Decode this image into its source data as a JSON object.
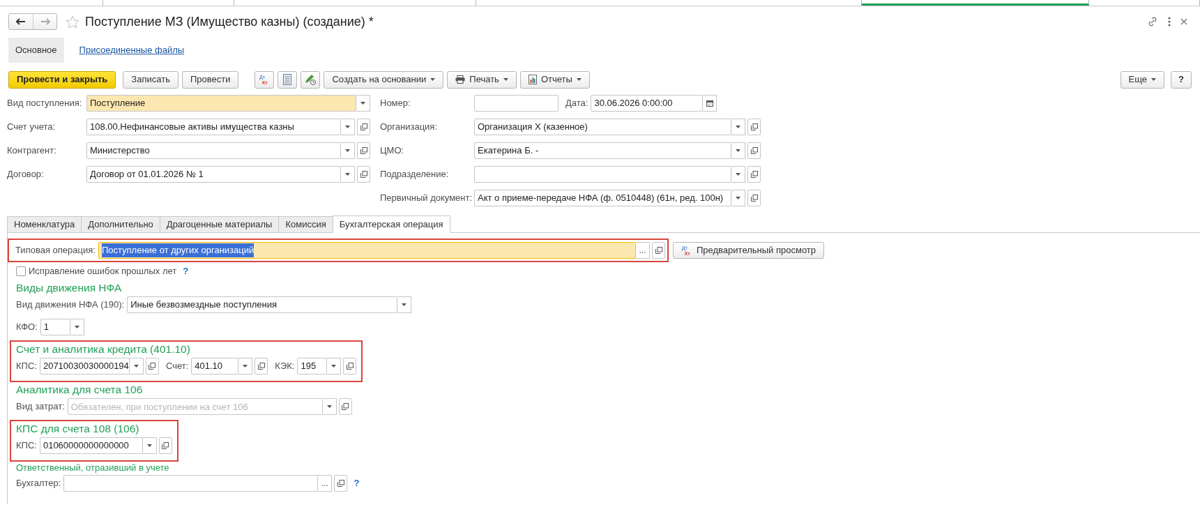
{
  "open_windows": [
    {
      "selected": false
    },
    {
      "selected": false
    },
    {
      "selected": false
    },
    {
      "selected": false
    },
    {
      "selected": true
    },
    {
      "selected": false
    }
  ],
  "window": {
    "title": "Поступление МЗ (Имущество казны) (создание) *",
    "favorite": false
  },
  "sections_nav": [
    {
      "label": "Основное",
      "selected": true
    },
    {
      "label": "Присоединенные файлы",
      "selected": false
    }
  ],
  "toolbar": [
    {
      "kind": "primary",
      "label": "Провести и закрыть"
    },
    {
      "kind": "button",
      "label": "Записать"
    },
    {
      "kind": "button",
      "label": "Провести"
    },
    {
      "kind": "dtkt",
      "marks": [
        "Дт",
        "Кт"
      ]
    },
    {
      "kind": "list"
    },
    {
      "kind": "edit"
    },
    {
      "kind": "menu",
      "label": "Создать на основании"
    },
    {
      "kind": "print",
      "label": "Печать"
    },
    {
      "kind": "report",
      "label": "Отчеты"
    }
  ],
  "toolbar_right": {
    "more": "Еще",
    "help": "?"
  },
  "header": {
    "left": [
      {
        "label": "Вид поступления:",
        "value": "Поступление",
        "kind": "choice",
        "highlighted": true
      },
      {
        "label": "Счет учета:",
        "value": "108.00.Нефинансовые активы имущества казны",
        "kind": "select",
        "highlighted": false
      },
      {
        "label": "Контрагент:",
        "value": "Министерство",
        "kind": "select",
        "highlighted": false
      },
      {
        "label": "Договор:",
        "value": "Договор от 01.01.2026 № 1",
        "kind": "select",
        "highlighted": false
      }
    ],
    "right": [
      [
        {
          "label": "Номер:",
          "kind": "text",
          "highlighted": false
        },
        {
          "label": "Дата:",
          "value": "30.06.2026  0:00:00",
          "kind": "date",
          "highlighted": false
        }
      ],
      [
        {
          "label": "Организация:",
          "value": "Организация Х (казенное)",
          "kind": "select",
          "highlighted": false
        }
      ],
      [
        {
          "label": "ЦМО:",
          "value": "Екатерина Б. -",
          "kind": "select",
          "highlighted": false
        }
      ],
      [
        {
          "label": "Подразделение:",
          "kind": "select",
          "highlighted": false
        }
      ],
      [
        {
          "label": "Первичный документ:",
          "value": "Акт о приеме-передаче НФА (ф. 0510448) (61н, ред. 100н)",
          "kind": "select",
          "highlighted": false
        }
      ]
    ]
  },
  "tabs": [
    {
      "label": "Номенклатура",
      "selected": false
    },
    {
      "label": "Дополнительно",
      "selected": false
    },
    {
      "label": "Драгоценные материалы",
      "selected": false
    },
    {
      "label": "Комиссия",
      "selected": false
    },
    {
      "label": "Бухгалтерская операция",
      "selected": true
    }
  ],
  "operation": {
    "framed": true,
    "field": {
      "label": "Типовая операция:",
      "value": "Поступление от других организаций",
      "kind": "lookup",
      "picker": "...",
      "highlighted": true,
      "text_selected": true
    },
    "preview_button": "Предварительный просмотр",
    "preview_marks": [
      "Дт",
      "Кт"
    ]
  },
  "correction": {
    "label": "Исправление ошибок прошлых лет",
    "checked": false,
    "help": "?"
  },
  "groups": [
    {
      "heading": "Виды движения НФА",
      "minor": false,
      "framed": false,
      "rows": [
        [
          {
            "label": "Вид движения НФА (190):",
            "value": "Иные безвозмездные поступления",
            "kind": "choice",
            "highlighted": false
          }
        ],
        [
          {
            "label": "КФО:",
            "value": "1",
            "kind": "choice",
            "highlighted": false
          }
        ]
      ]
    },
    {
      "heading": "Счет и аналитика кредита (401.10)",
      "minor": false,
      "framed": true,
      "rows": [
        [
          {
            "label": "КПС:",
            "value": "20710030030000194",
            "kind": "select",
            "highlighted": false
          },
          {
            "label": "Счет:",
            "value": "401.10",
            "kind": "select",
            "highlighted": false
          },
          {
            "label": "КЭК:",
            "value": "195",
            "kind": "select",
            "highlighted": false
          }
        ]
      ]
    },
    {
      "heading": "Аналитика для счета 106",
      "minor": false,
      "framed": false,
      "rows": [
        [
          {
            "label": "Вид затрат:",
            "placeholder": "Обязателен, при поступлении на счет 106",
            "kind": "select",
            "highlighted": false
          }
        ]
      ]
    },
    {
      "heading": "КПС для счета 108 (106)",
      "minor": false,
      "framed": true,
      "rows": [
        [
          {
            "label": "КПС:",
            "value": "01060000000000000",
            "kind": "select",
            "highlighted": false
          }
        ]
      ]
    },
    {
      "heading": "Ответственный, отразивший в учете",
      "minor": true,
      "framed": false,
      "rows": [
        [
          {
            "label": "Бухгалтер:",
            "kind": "lookup",
            "picker": "...",
            "highlighted": false,
            "help": "?"
          }
        ]
      ]
    }
  ]
}
